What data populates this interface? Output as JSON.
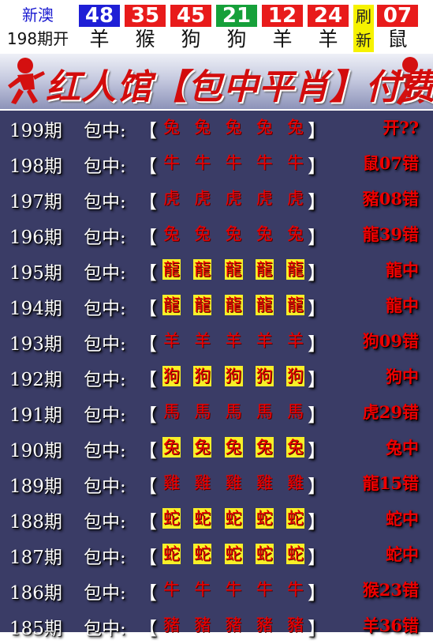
{
  "header": {
    "region": "新澳",
    "issue": "198期开",
    "balls": [
      {
        "num": "48",
        "zodiac": "羊",
        "color": "#1f1fd6"
      },
      {
        "num": "35",
        "zodiac": "猴",
        "color": "#e81b1b"
      },
      {
        "num": "45",
        "zodiac": "狗",
        "color": "#e81b1b"
      },
      {
        "num": "21",
        "zodiac": "狗",
        "color": "#16a03a"
      },
      {
        "num": "12",
        "zodiac": "羊",
        "color": "#e81b1b"
      },
      {
        "num": "24",
        "zodiac": "羊",
        "color": "#e81b1b"
      }
    ],
    "refresh": [
      "刷",
      "新"
    ],
    "special": {
      "num": "07",
      "zodiac": "鼠",
      "color": "#e81b1b"
    }
  },
  "banner": {
    "title": "红人馆【包中平肖】付费版"
  },
  "table": {
    "label": "包中:",
    "open_bracket": "【",
    "close_bracket": "】",
    "rows": [
      {
        "period": "199期",
        "zodiacs": [
          "兔",
          "兔",
          "兔",
          "兔",
          "兔"
        ],
        "result": "开??",
        "hit": false
      },
      {
        "period": "198期",
        "zodiacs": [
          "牛",
          "牛",
          "牛",
          "牛",
          "牛"
        ],
        "result": "鼠07错",
        "hit": false
      },
      {
        "period": "197期",
        "zodiacs": [
          "虎",
          "虎",
          "虎",
          "虎",
          "虎"
        ],
        "result": "豬08错",
        "hit": false
      },
      {
        "period": "196期",
        "zodiacs": [
          "兔",
          "兔",
          "兔",
          "兔",
          "兔"
        ],
        "result": "龍39错",
        "hit": false
      },
      {
        "period": "195期",
        "zodiacs": [
          "龍",
          "龍",
          "龍",
          "龍",
          "龍"
        ],
        "result": "龍中",
        "hit": true
      },
      {
        "period": "194期",
        "zodiacs": [
          "龍",
          "龍",
          "龍",
          "龍",
          "龍"
        ],
        "result": "龍中",
        "hit": true
      },
      {
        "period": "193期",
        "zodiacs": [
          "羊",
          "羊",
          "羊",
          "羊",
          "羊"
        ],
        "result": "狗09错",
        "hit": false
      },
      {
        "period": "192期",
        "zodiacs": [
          "狗",
          "狗",
          "狗",
          "狗",
          "狗"
        ],
        "result": "狗中",
        "hit": true
      },
      {
        "period": "191期",
        "zodiacs": [
          "馬",
          "馬",
          "馬",
          "馬",
          "馬"
        ],
        "result": "虎29错",
        "hit": false
      },
      {
        "period": "190期",
        "zodiacs": [
          "兔",
          "兔",
          "兔",
          "兔",
          "兔"
        ],
        "result": "兔中",
        "hit": true
      },
      {
        "period": "189期",
        "zodiacs": [
          "雞",
          "雞",
          "雞",
          "雞",
          "雞"
        ],
        "result": "龍15错",
        "hit": false
      },
      {
        "period": "188期",
        "zodiacs": [
          "蛇",
          "蛇",
          "蛇",
          "蛇",
          "蛇"
        ],
        "result": "蛇中",
        "hit": true
      },
      {
        "period": "187期",
        "zodiacs": [
          "蛇",
          "蛇",
          "蛇",
          "蛇",
          "蛇"
        ],
        "result": "蛇中",
        "hit": true
      },
      {
        "period": "186期",
        "zodiacs": [
          "牛",
          "牛",
          "牛",
          "牛",
          "牛"
        ],
        "result": "猴23错",
        "hit": false
      },
      {
        "period": "185期",
        "zodiacs": [
          "豬",
          "豬",
          "豬",
          "豬",
          "豬"
        ],
        "result": "羊36错",
        "hit": false
      }
    ]
  }
}
